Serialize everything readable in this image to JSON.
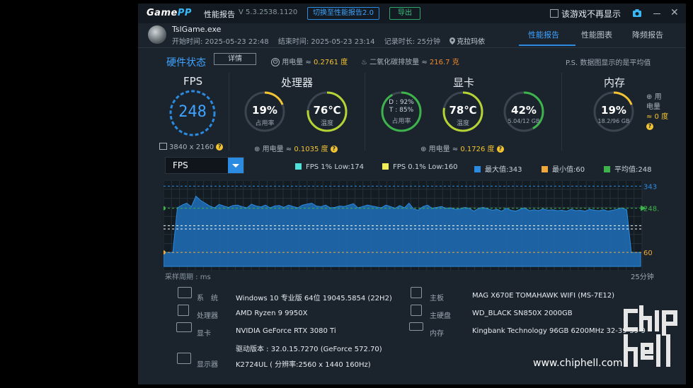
{
  "app": {
    "logo_a": "Game",
    "logo_b": "PP",
    "title": "性能报告",
    "version": "V 5.3.2538.1120",
    "switch_button": "切换至性能报告2.0",
    "export_button": "导出",
    "dont_show_label": "该游戏不再显示",
    "close_glyph": "✕"
  },
  "session": {
    "process": "TslGame.exe",
    "start": "开始时间: 2025-05-23 22:48",
    "end": "结束时间: 2025-05-23 23:14",
    "duration": "记录时长: 25分钟",
    "location": "克拉玛依"
  },
  "tabs": [
    "性能报告",
    "性能图表",
    "降频报告"
  ],
  "summary": {
    "hw_title": "硬件状态",
    "detail_button": "详情",
    "power_label": "用电量 ≈",
    "power_value": "0.2761 度",
    "co2_label": "二氧化碳排放量 ≈",
    "co2_value": "216.7 克",
    "note": "P.S. 数据图显示的是平均值"
  },
  "fps_panel": {
    "title": "FPS",
    "value": "248",
    "resolution": "3840 x 2160"
  },
  "cpu_panel": {
    "title": "处理器",
    "usage_value": "19%",
    "usage_label": "占用率",
    "usage_fraction": 0.19,
    "temp_value": "76℃",
    "temp_label": "温度",
    "temp_fraction": 0.76,
    "power_label": "用电量 ≈",
    "power_value": "0.1035 度"
  },
  "gpu_panel": {
    "title": "显卡",
    "dt_line1": "D : 92%",
    "dt_line2": "T : 85%",
    "usage_label": "占用率",
    "usage_fraction": 0.92,
    "temp_value": "78℃",
    "temp_label": "温度",
    "temp_fraction": 0.78,
    "vram_value": "42%",
    "vram_label": "5.04/12 GB",
    "vram_fraction": 0.42,
    "power_label": "用电量 ≈",
    "power_value": "0.1726 度"
  },
  "mem_panel": {
    "title": "内存",
    "value": "19%",
    "label": "18.2/96 GB",
    "fraction": 0.19,
    "power_label_1": "用",
    "power_label_2": "电量",
    "power_value": "≈ 0 度"
  },
  "chart_controls": {
    "metric": "FPS",
    "legend": [
      {
        "label": "FPS 1% Low:174",
        "color": "#4fe0d9"
      },
      {
        "label": "FPS 0.1% Low:160",
        "color": "#f2ee5a"
      },
      {
        "label": "最大值:343",
        "color": "#2a8be0"
      },
      {
        "label": "最小值:60",
        "color": "#f0a83a"
      },
      {
        "label": "平均值:248",
        "color": "#3cb44b"
      }
    ],
    "period_label": "采样周期 : ms",
    "duration_label": "25分钟"
  },
  "chart_data": {
    "type": "area",
    "series": [
      {
        "name": "FPS",
        "values": [
          60,
          60,
          60,
          250,
          262,
          270,
          255,
          300,
          282,
          270,
          258,
          250,
          265,
          258,
          252,
          260,
          262,
          255,
          250,
          266,
          258,
          254,
          262,
          250,
          258,
          260,
          252,
          262,
          256,
          250,
          262,
          266,
          270,
          258,
          255,
          262,
          250,
          252,
          258,
          256,
          262,
          268,
          250,
          256,
          262,
          258,
          254,
          250,
          262,
          256,
          248,
          260,
          250,
          270,
          245,
          240,
          255,
          262,
          248,
          252,
          256,
          248,
          250,
          244,
          246,
          252,
          248,
          236,
          248,
          252,
          246,
          240,
          244,
          236,
          248,
          240,
          236,
          244,
          250,
          238,
          242,
          238,
          246,
          240,
          242,
          238,
          240,
          236,
          244,
          238,
          240,
          236,
          244,
          240,
          238,
          242,
          236,
          240,
          245,
          250,
          242,
          60,
          60,
          60
        ]
      }
    ],
    "ylim": [
      0,
      343
    ],
    "right_tick_labels": [
      "343",
      "248.36",
      "60"
    ],
    "reference_lines": [
      {
        "name": "max",
        "value": 343
      },
      {
        "name": "average",
        "value": 248.36
      },
      {
        "name": "1% low",
        "value": 174
      },
      {
        "name": "0.1% low",
        "value": 160
      },
      {
        "name": "min",
        "value": 60
      }
    ]
  },
  "specs": [
    {
      "key": "系　统",
      "value": "Windows 10 专业版 64位 19045.5854 (22H2)"
    },
    {
      "key": "处理器",
      "value": "AMD Ryzen 9 9950X"
    },
    {
      "key": "显卡",
      "value": "NVIDIA GeForce RTX 3080 Ti"
    },
    {
      "key": "",
      "value": "驱动版本 : 32.0.15.7270 (GeForce 572.70)"
    },
    {
      "key": "显示器",
      "value": "K2724UL ( 分辨率:2560 x 1440 160Hz)"
    },
    {
      "key": "主板",
      "value": "MAG X670E TOMAHAWK WIFI (MS-7E12)"
    },
    {
      "key": "主硬盘",
      "value": "WD_BLACK SN850X 2000GB"
    },
    {
      "key": "内存",
      "value": "Kingbank Technology 96GB 6200MHz 32-39-39-9"
    }
  ],
  "watermark": {
    "text": "www.chiphell.com",
    "logo_text": "chip hell"
  }
}
